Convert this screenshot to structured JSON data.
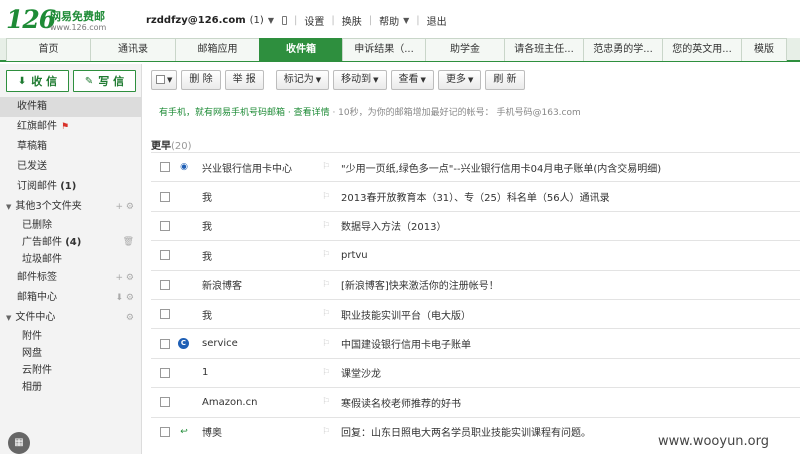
{
  "brand": {
    "logo_number": "126",
    "logo_name": "网易免费邮",
    "logo_url": "www.126.com"
  },
  "user": {
    "email": "rzddfzy@126.com",
    "count": "(1)"
  },
  "top_links": [
    "设置",
    "换肤",
    "帮助",
    "退出"
  ],
  "tabs": [
    {
      "label": "首页"
    },
    {
      "label": "通讯录"
    },
    {
      "label": "邮箱应用"
    },
    {
      "label": "收件箱"
    },
    {
      "label": "申诉结果（..."
    },
    {
      "label": "助学金"
    },
    {
      "label": "请各班主任..."
    },
    {
      "label": "范忠勇的学..."
    },
    {
      "label": "您的英文用..."
    },
    {
      "label": "模版"
    }
  ],
  "compose": {
    "receive_label": "收 信",
    "write_label": "写 信"
  },
  "sidebar": {
    "inbox": "收件箱",
    "starred": "红旗邮件",
    "drafts": "草稿箱",
    "sent": "已发送",
    "subscription": "订阅邮件",
    "subscription_count": "(1)",
    "other_folders": "其他3个文件夹",
    "deleted": "已删除",
    "ads": "广告邮件",
    "ads_count": "(4)",
    "spam": "垃圾邮件",
    "tags": "邮件标签",
    "mail_center": "邮箱中心",
    "file_center": "文件中心",
    "attachments": "附件",
    "netdisk": "网盘",
    "cloud_attach": "云附件",
    "album": "相册"
  },
  "toolbar": {
    "delete": "删 除",
    "report": "举 报",
    "mark_as": "标记为",
    "move_to": "移动到",
    "view": "查看",
    "more": "更多",
    "refresh": "刷 新"
  },
  "tip": {
    "highlight": "有手机，就有网易手机号码邮箱 · 查看详情",
    "rest": " · 10秒，为你的邮箱增加最好记的帐号： 手机号码@163.com"
  },
  "section": {
    "label": "更早",
    "count": "(20)"
  },
  "emails": [
    {
      "from": "兴业银行信用卡中心",
      "subject": "\"少用一页纸,绿色多一点\"--兴业银行信用卡04月电子账单(内含交易明细)",
      "status": "read"
    },
    {
      "from": "我",
      "subject": "2013春开放教育本（31）、专（25）科名单（56人）通讯录",
      "status": ""
    },
    {
      "from": "我",
      "subject": "数据导入方法（2013）",
      "status": ""
    },
    {
      "from": "我",
      "subject": "prtvu",
      "status": ""
    },
    {
      "from": "新浪博客",
      "subject": "[新浪博客]快来激活你的注册帐号！",
      "status": ""
    },
    {
      "from": "我",
      "subject": "职业技能实训平台（电大版）",
      "status": ""
    },
    {
      "from": "service",
      "subject": "中国建设银行信用卡电子账单",
      "status": "svc"
    },
    {
      "from": "1",
      "subject": "课堂沙龙",
      "status": ""
    },
    {
      "from": "Amazon.cn",
      "subject": "寒假读名校老师推荐的好书",
      "status": ""
    },
    {
      "from": "博奥",
      "subject": "回复：山东日照电大两名学员职业技能实训课程有问题。",
      "status": "reply"
    }
  ],
  "watermark": "www.wooyun.org",
  "colors": {
    "brand_green": "#2e8f3e",
    "link_blue": "#1f5fb5"
  }
}
